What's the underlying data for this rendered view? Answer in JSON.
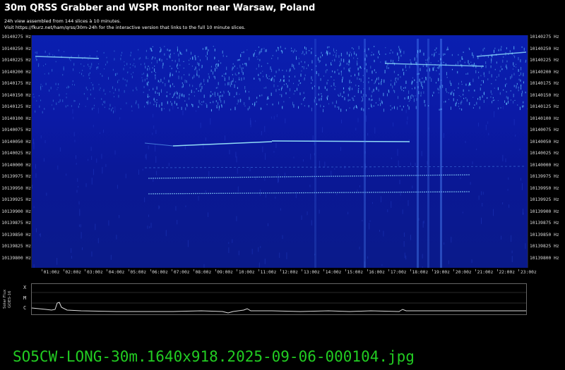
{
  "header": {
    "title": "30m QRSS Grabber and WSPR monitor near Warsaw, Poland",
    "line1": "24h view assembled from 144 slices à 10 minutes.",
    "line2": "Visit https://fkurz.net/ham/qrss/30m-24h for the interactive version that links to the full 10 minute slices."
  },
  "frequency_labels": [
    "10140275 Hz",
    "10140250 Hz",
    "10140225 Hz",
    "10140200 Hz",
    "10140175 Hz",
    "10140150 Hz",
    "10140125 Hz",
    "10140100 Hz",
    "10140075 Hz",
    "10140050 Hz",
    "10140025 Hz",
    "10140000 Hz",
    "10139975 Hz",
    "10139950 Hz",
    "10139925 Hz",
    "10139900 Hz",
    "10139875 Hz",
    "10139850 Hz",
    "10139825 Hz",
    "10139800 Hz"
  ],
  "time_labels": [
    "01:00z",
    "02:00z",
    "03:00z",
    "04:00z",
    "05:00z",
    "06:00z",
    "07:00z",
    "08:00z",
    "09:00z",
    "10:00z",
    "11:00z",
    "12:00z",
    "13:00z",
    "14:00z",
    "15:00z",
    "16:00z",
    "17:00z",
    "18:00z",
    "19:00z",
    "20:00z",
    "21:00z",
    "22:00z",
    "23:00z"
  ],
  "solar_flux": {
    "ylabel_line1": "Solar Flux",
    "ylabel_line2": "GOES-16",
    "classes": [
      "X",
      "M",
      "C"
    ]
  },
  "footer": {
    "filename": "SO5CW-LONG-30m.1640x918.2025-09-06-000104.jpg"
  },
  "colors": {
    "background": "#000000",
    "spectrogram_base": "#0a1aa0",
    "signal": "#7fd8ff",
    "filename_text": "#22cc22"
  }
}
